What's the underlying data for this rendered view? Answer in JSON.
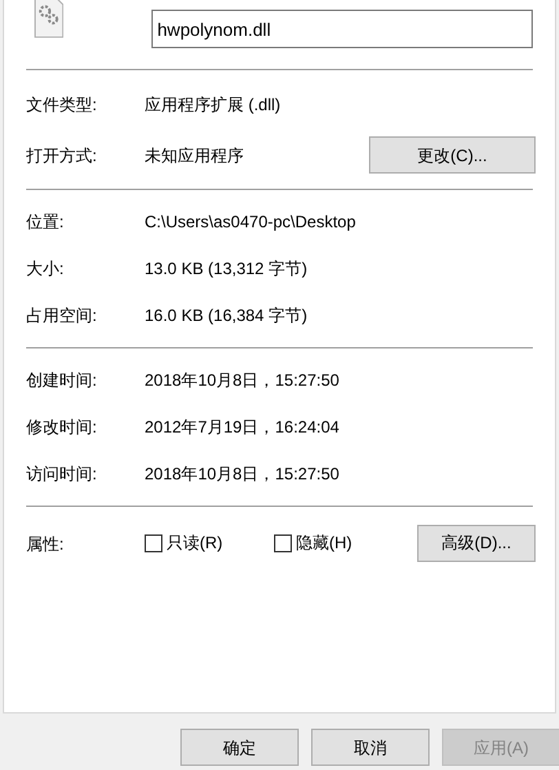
{
  "file_name": "hwpolynom.dll",
  "sections": [
    [
      {
        "label": "文件类型:",
        "value": "应用程序扩展 (.dll)"
      },
      {
        "label": "打开方式:",
        "value": "未知应用程序",
        "button": "更改(C)..."
      }
    ],
    [
      {
        "label": "位置:",
        "value": "C:\\Users\\as0470-pc\\Desktop"
      },
      {
        "label": "大小:",
        "value": "13.0 KB (13,312 字节)"
      },
      {
        "label": "占用空间:",
        "value": "16.0 KB (16,384 字节)"
      }
    ],
    [
      {
        "label": "创建时间:",
        "value": "2018年10月8日，15:27:50"
      },
      {
        "label": "修改时间:",
        "value": "2012年7月19日，16:24:04"
      },
      {
        "label": "访问时间:",
        "value": "2018年10月8日，15:27:50"
      }
    ]
  ],
  "attributes": {
    "label": "属性:",
    "options": [
      {
        "label": "只读(R)",
        "checked": false
      },
      {
        "label": "隐藏(H)",
        "checked": false
      }
    ],
    "button": "高级(D)..."
  },
  "buttons": [
    {
      "label": "确定",
      "disabled": false
    },
    {
      "label": "取消",
      "disabled": false
    },
    {
      "label": "应用(A)",
      "disabled": true
    }
  ]
}
